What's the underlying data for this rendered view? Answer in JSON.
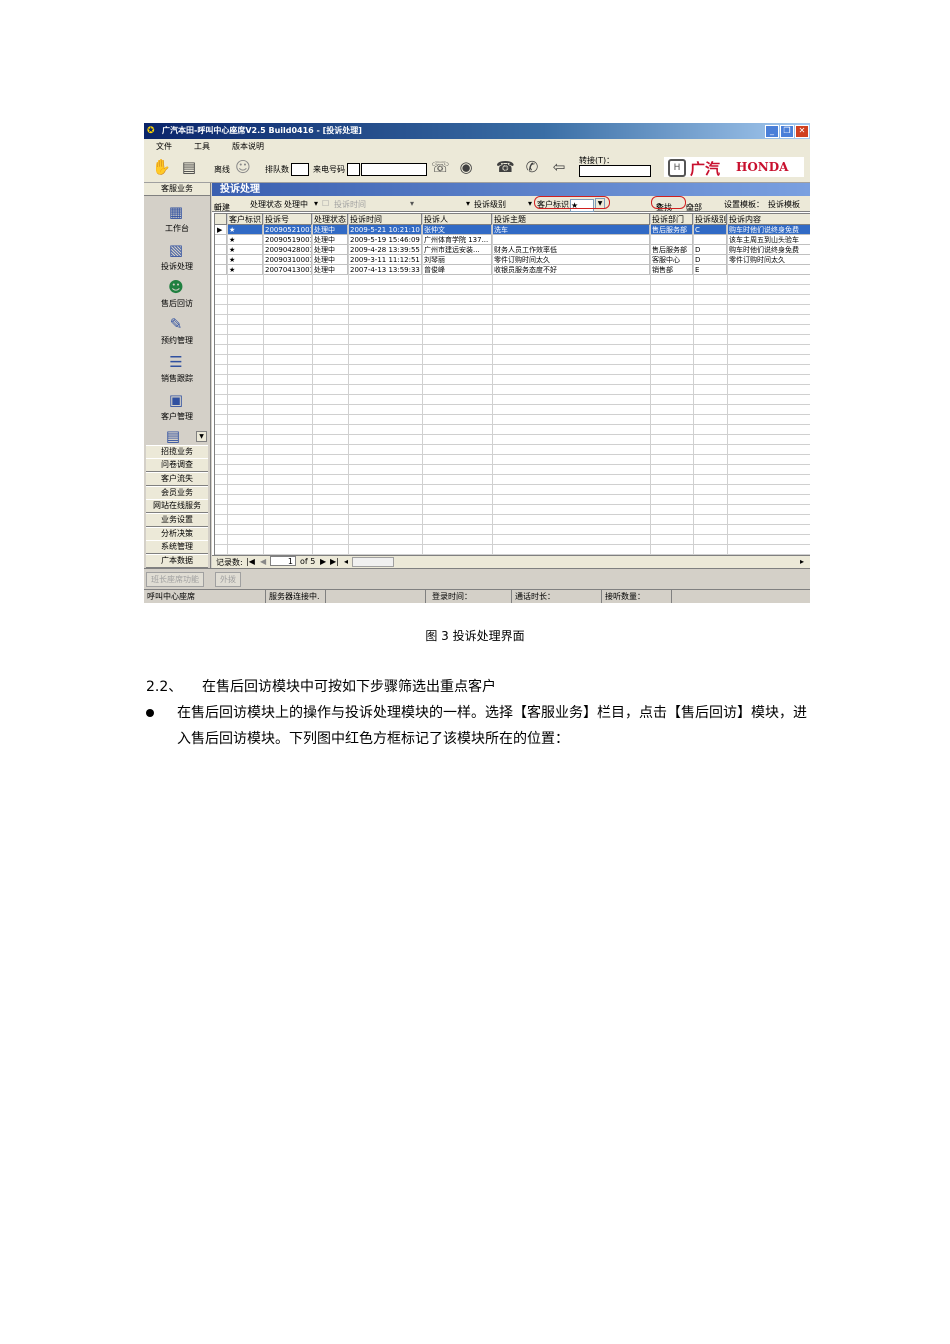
{
  "window": {
    "title": "广汽本田-呼叫中心座席V2.5 Build0416 - [投诉处理]"
  },
  "menu": [
    "文件",
    "工具",
    "版本说明"
  ],
  "toolbar": {
    "offline": "离线",
    "queue": "排队数",
    "caller_no": "来电号码",
    "transfer_label": "转接(T)：",
    "logo_gac": "广汽",
    "logo_honda": "HONDA"
  },
  "sidebar": {
    "header": "客服业务",
    "items": [
      {
        "label": "工作台",
        "icon": "workbench-icon"
      },
      {
        "label": "投诉处理",
        "icon": "complaint-icon"
      },
      {
        "label": "售后回访",
        "icon": "aftersales-icon"
      },
      {
        "label": "预约管理",
        "icon": "appointment-icon"
      },
      {
        "label": "销售跟踪",
        "icon": "sales-icon"
      },
      {
        "label": "客户管理",
        "icon": "customer-icon"
      }
    ],
    "buttons": [
      "招揽业务",
      "问卷调查",
      "客户流失",
      "会员业务",
      "网站在线服务",
      "业务设置",
      "分析决策",
      "系统管理",
      "广本数据"
    ]
  },
  "main": {
    "title": "投诉处理",
    "filter": {
      "new_btn": "新建",
      "status_label": "处理状态",
      "status_value": "处理中",
      "time_label": "投诉时间",
      "level_label": "投诉级别",
      "customer_flag_label": "客户标识",
      "customer_flag_value": "★",
      "search_btn": "查找",
      "all_btn": "全部",
      "template_label": "设置模板：",
      "template_value": "投诉模板"
    },
    "columns": [
      "客户标识",
      "投诉号",
      "处理状态",
      "投诉时间",
      "投诉人",
      "投诉主题",
      "投诉部门",
      "投诉级别",
      "投诉内容"
    ],
    "rows": [
      [
        "★",
        "20090521001",
        "处理中",
        "2009-5-21 10:21:10",
        "张仲文",
        "洗车",
        "售后服务部",
        "C",
        "购车时他们说终身免费"
      ],
      [
        "★",
        "20090519001",
        "处理中",
        "2009-5-19 15:46:09",
        "广州体育学院 137...",
        "",
        "",
        "",
        "该车主周五到山头验车"
      ],
      [
        "★",
        "20090428001",
        "处理中",
        "2009-4-28 13:39:55",
        "广州市建远安装...",
        "财务人员工作效率低",
        "售后服务部",
        "D",
        "购车时他们说终身免费"
      ],
      [
        "★",
        "20090310001",
        "处理中",
        "2009-3-11 11:12:51",
        "刘琴丽",
        "零件订购时间太久",
        "客服中心",
        "D",
        "零件订购时间太久"
      ],
      [
        "★",
        "20070413001",
        "处理中",
        "2007-4-13 13:59:33",
        "曾俊峰",
        "收银员服务态度不好",
        "销售部",
        "E",
        ""
      ]
    ],
    "pager": {
      "record_label": "记录数:",
      "current": "1",
      "of_text": "of 5"
    }
  },
  "bottom_buttons": [
    "班长座席功能",
    "外拨"
  ],
  "status": {
    "seat": "呼叫中心座席",
    "server": "服务器连接中.",
    "login_time": "登录时间：",
    "call_duration": "通话时长：",
    "listen_count": "接听数量："
  },
  "doc": {
    "caption": "图 3 投诉处理界面",
    "section_number": "2.2、",
    "section_title": "在售后回访模块中可按如下步骤筛选出重点客户",
    "bullet_text": "在售后回访模块上的操作与投诉处理模块的一样。选择【客服业务】栏目，点击【售后回访】模块，进入售后回访模块。下列图中红色方框标记了该模块所在的位置："
  },
  "colors": {
    "selection": "#316ac5",
    "red_highlight": "#d02020",
    "brand_red": "#c8102e"
  }
}
